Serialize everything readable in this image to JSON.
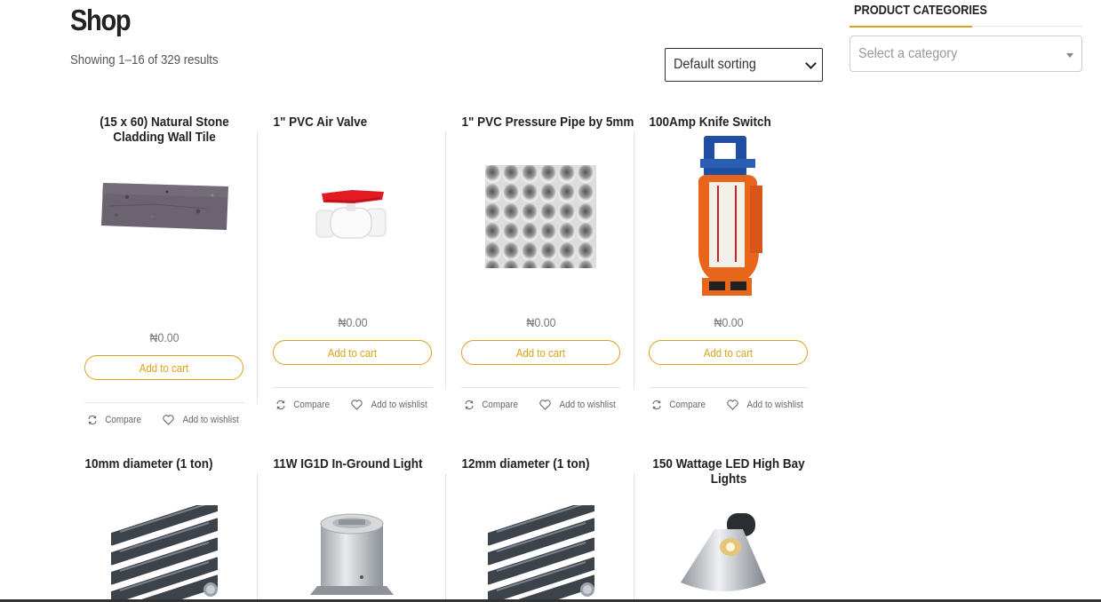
{
  "page": {
    "title": "Shop",
    "result_count": "Showing 1–16 of 329 results",
    "sorting": {
      "selected": "Default sorting"
    }
  },
  "sidebar": {
    "heading": "PRODUCT CATEGORIES",
    "category_select_placeholder": "Select a category"
  },
  "colors": {
    "accent": "#d9a21b",
    "text": "#222222",
    "muted": "#777777"
  },
  "actions": {
    "compare": "Compare",
    "wishlist": "Add to wishlist"
  },
  "products": [
    {
      "title": "(15 x 60) Natural Stone Cladding Wall Tile",
      "price": "₦0.00",
      "button": "Add to cart",
      "image": "stone-tile"
    },
    {
      "title": "1\" PVC Air Valve",
      "price": "₦0.00",
      "button": "Add to cart",
      "image": "pvc-valve"
    },
    {
      "title": "1\" PVC Pressure Pipe by 5mm",
      "price": "₦0.00",
      "button": "Add to cart",
      "image": "pvc-pipes"
    },
    {
      "title": "100Amp Knife Switch",
      "price": "₦0.00",
      "button": "Add to cart",
      "image": "knife-switch"
    },
    {
      "title": "10mm diameter (1 ton)",
      "image": "rebar"
    },
    {
      "title": "11W IG1D In-Ground Light",
      "image": "inground-light"
    },
    {
      "title": "12mm diameter (1 ton)",
      "image": "rebar"
    },
    {
      "title": "150 Wattage LED High Bay Lights",
      "image": "highbay-light"
    }
  ]
}
